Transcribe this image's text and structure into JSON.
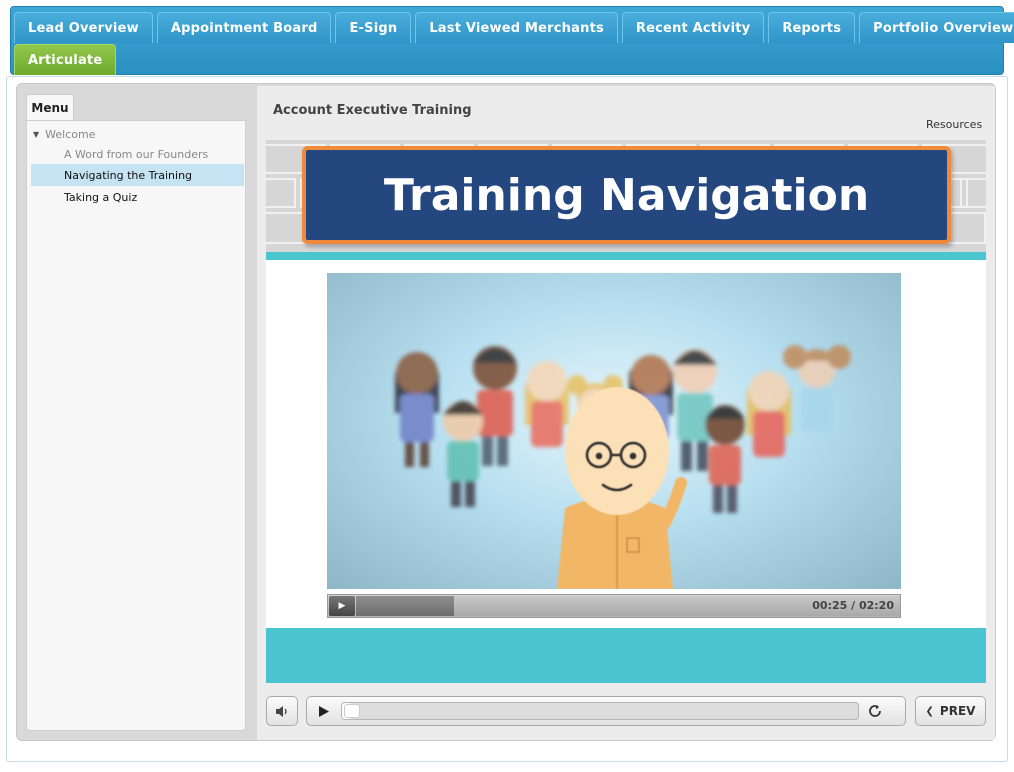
{
  "topnav": {
    "tabs_row1": [
      {
        "label": "Lead Overview",
        "name": "tab-lead-overview"
      },
      {
        "label": "Appointment Board",
        "name": "tab-appointment-board"
      },
      {
        "label": "E-Sign",
        "name": "tab-e-sign"
      },
      {
        "label": "Last Viewed Merchants",
        "name": "tab-last-viewed-merchants"
      },
      {
        "label": "Recent Activity",
        "name": "tab-recent-activity"
      },
      {
        "label": "Reports",
        "name": "tab-reports"
      },
      {
        "label": "Portfolio Overview",
        "name": "tab-portfolio-overview"
      }
    ],
    "tabs_row2": [
      {
        "label": "Articulate",
        "name": "tab-articulate",
        "active": true
      }
    ]
  },
  "sidebar": {
    "tab_label": "Menu",
    "items": [
      {
        "label": "Welcome"
      },
      {
        "label": "A Word from our Founders"
      },
      {
        "label": "Navigating the Training",
        "selected": true
      },
      {
        "label": "Taking a Quiz"
      }
    ]
  },
  "content": {
    "course_title": "Account Executive Training",
    "resources_label": "Resources"
  },
  "slide": {
    "title": "Training Navigation",
    "video": {
      "time": "00:25 / 02:20",
      "buffered_fraction": 0.18
    }
  },
  "player": {
    "prev_label": "PREV",
    "progress_fraction": 0.02
  },
  "colors": {
    "nav_blue": "#2a90c2",
    "active_green": "#6ea92d",
    "title_box": "#23477e",
    "title_border": "#f08a3a",
    "teal": "#4cc4cf",
    "menu_selected": "#c5e3f3"
  }
}
